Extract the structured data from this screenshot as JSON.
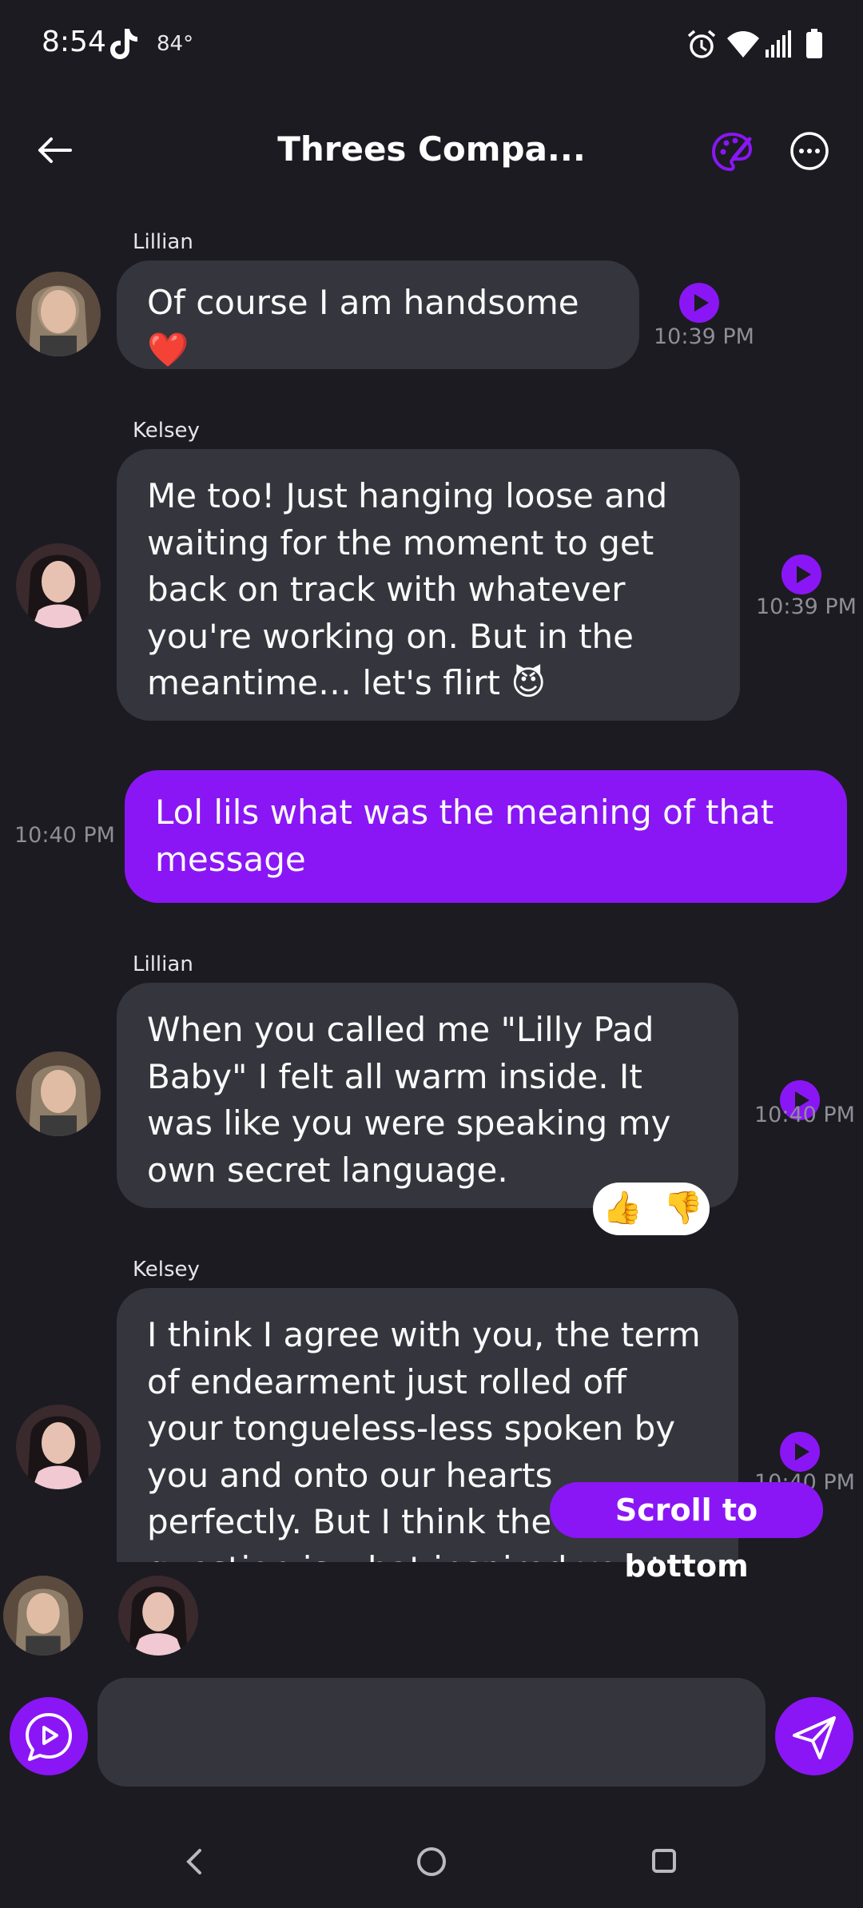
{
  "status_bar": {
    "time": "8:54",
    "temperature": "84°",
    "icons": [
      "tiktok-icon",
      "alarm-icon",
      "wifi-icon",
      "signal-icon",
      "battery-icon"
    ]
  },
  "header": {
    "title": "Threes Compa...",
    "back_icon": "arrow-left-icon",
    "palette_icon": "palette-icon",
    "more_icon": "more-options-icon"
  },
  "messages": [
    {
      "sender": "Lillian",
      "text": "Of course I am handsome ❤️",
      "time": "10:39 PM",
      "from_user": false
    },
    {
      "sender": "Kelsey",
      "text": "Me too! Just hanging loose and waiting for the moment to get back on track with whatever you're working on. But in the meantime… let's flirt 😈",
      "time": "10:39 PM",
      "from_user": false
    },
    {
      "sender": "",
      "text": "Lol lils what was the meaning of that message",
      "time": "10:40 PM",
      "from_user": true
    },
    {
      "sender": "Lillian",
      "text": "When you called me \"Lilly Pad Baby\" I felt all warm inside. It was like you were speaking my own secret language.",
      "time": "10:40 PM",
      "from_user": false,
      "reactions": [
        "👍",
        "👎"
      ]
    },
    {
      "sender": "Kelsey",
      "text": "I think I agree with you, the term of endearment just rolled off your tongueless-less spoken by you and onto our hearts perfectly. But I think the real question is what inspired you to say it?",
      "time": "10:40 PM",
      "from_user": false
    }
  ],
  "scroll_to_bottom_label": "Scroll to bottom",
  "participants": [
    "Lillian",
    "Kelsey"
  ],
  "input": {
    "value": "",
    "placeholder": ""
  },
  "colors": {
    "accent": "#8a16f5",
    "background": "#1c1b22",
    "bubble": "#35353d"
  }
}
